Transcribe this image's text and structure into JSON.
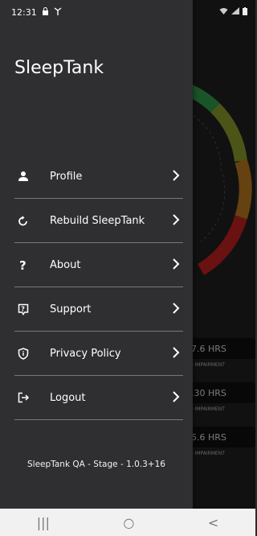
{
  "status": {
    "time": "12:31"
  },
  "drawer": {
    "app_name": "SleepTank",
    "items": [
      {
        "label": "Profile",
        "icon": "person-icon"
      },
      {
        "label": "Rebuild SleepTank",
        "icon": "refresh-icon"
      },
      {
        "label": "About",
        "icon": "question-icon"
      },
      {
        "label": "Support",
        "icon": "support-icon"
      },
      {
        "label": "Privacy Policy",
        "icon": "shield-icon"
      },
      {
        "label": "Logout",
        "icon": "logout-icon"
      }
    ],
    "version": "SleepTank QA - Stage - 1.0.3+16"
  },
  "background": {
    "cards": [
      {
        "value": "7.6 HRS",
        "sub": "D IMPAIRMENT"
      },
      {
        "value": ".30 HRS",
        "sub": "D IMPAIRMENT"
      },
      {
        "value": "5.6 HRS",
        "sub": "D IMPAIRMENT"
      }
    ]
  },
  "nav": {
    "recents": "|||",
    "home": "○",
    "back": "<"
  }
}
